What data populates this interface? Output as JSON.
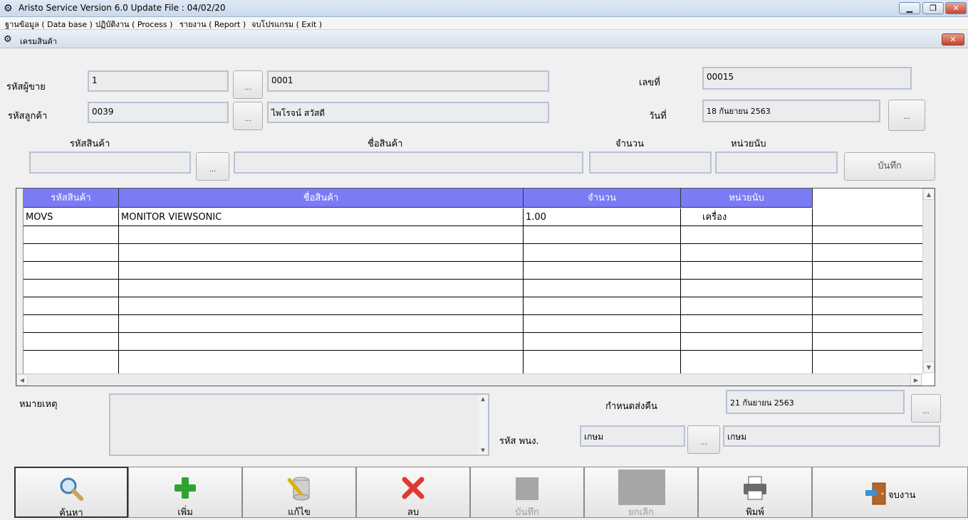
{
  "window": {
    "title": "Aristo Service Version 6.0 Update File : 04/02/20"
  },
  "menu": [
    "ฐานข้อมูล ( Data base )",
    "ปฏิบัติงาน ( Process )",
    "รายงาน ( Report )",
    "จบโปรแกรม ( Exit )"
  ],
  "child": {
    "title": "เครมสินค้า"
  },
  "form": {
    "seller_label": "รหัสผู้ขาย",
    "seller_code": "1",
    "seller_name": "0001",
    "customer_label": "รหัสลูกค้า",
    "customer_code": "0039",
    "customer_name": "ไพโรจน์ สวัสดี",
    "number_label": "เลขที่",
    "number_value": "00015",
    "date_label": "วันที่",
    "date_value": "18 กันยายน 2563",
    "dots": "...",
    "item_code_label": "รหัสสินค้า",
    "item_name_label": "ชื่อสินค้า",
    "qty_label": "จำนวน",
    "unit_label": "หน่วยนับ",
    "save_label": "บันทึก"
  },
  "grid": {
    "columns": [
      "รหัสสินค้า",
      "ชื่อสินค้า",
      "จำนวน",
      "หน่วยนับ"
    ],
    "rows": [
      {
        "code": "MOVS",
        "name": "MONITOR VIEWSONIC",
        "qty": "1.00",
        "unit": "เครื่อง"
      }
    ]
  },
  "footer": {
    "remark_label": "หมายเหตุ",
    "return_label": "กำหนดส่งคืน",
    "return_date": "21 กันยายน 2563",
    "staff_label": "รหัส พนง.",
    "staff_code": "เกษม",
    "staff_name": "เกษม"
  },
  "toolbar": [
    {
      "label": "ค้นหา",
      "icon": "search-icon",
      "enabled": true
    },
    {
      "label": "เพิ่ม",
      "icon": "plus-icon",
      "enabled": true
    },
    {
      "label": "แก้ไข",
      "icon": "edit-database-icon",
      "enabled": true
    },
    {
      "label": "ลบ",
      "icon": "delete-icon",
      "enabled": true
    },
    {
      "label": "บันทึก",
      "icon": "save-placeholder-icon",
      "enabled": false
    },
    {
      "label": "ยกเลิก",
      "icon": "cancel-placeholder-icon",
      "enabled": false
    },
    {
      "label": "พิมพ์",
      "icon": "printer-icon",
      "enabled": true
    },
    {
      "label": "จบงาน",
      "icon": "exit-door-icon",
      "enabled": true
    }
  ]
}
